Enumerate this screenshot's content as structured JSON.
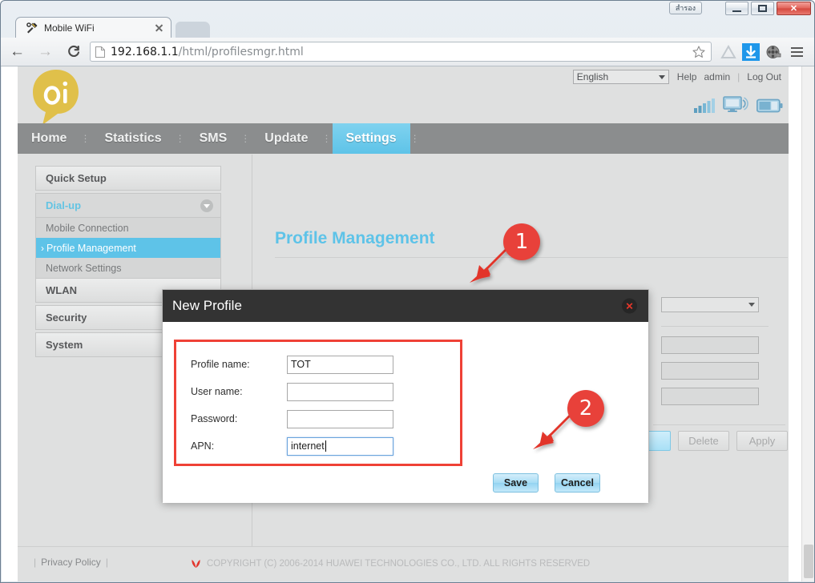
{
  "browser": {
    "window_buttons": {
      "thai_label": "สำรอง",
      "minimize": "minimize",
      "maximize": "maximize",
      "close": "✕"
    },
    "tab": {
      "title": "Mobile WiFi",
      "favicon": "tools-icon",
      "close": "✕"
    },
    "toolbar": {
      "back": "←",
      "forward": "→",
      "reload": "C",
      "url_host": "192.168.1.1",
      "url_path": "/html/profilesmgr.html",
      "star": "☆",
      "drive_icon": "drive-icon",
      "download_icon": "download-icon",
      "extension_icon": "film-reel-icon",
      "menu_icon": "hamburger-menu-icon"
    }
  },
  "site": {
    "logo_text": "oi",
    "language": {
      "selected": "English"
    },
    "header_links": [
      {
        "label": "Help"
      },
      {
        "label": "admin"
      },
      {
        "label": "Log Out"
      }
    ],
    "status_icons": [
      "signal-strength-icon",
      "wifi-monitor-icon",
      "battery-icon"
    ],
    "nav": [
      {
        "label": "Home",
        "active": false
      },
      {
        "label": "Statistics",
        "active": false
      },
      {
        "label": "SMS",
        "active": false
      },
      {
        "label": "Update",
        "active": false
      },
      {
        "label": "Settings",
        "active": true
      }
    ]
  },
  "sidebar": {
    "groups": [
      {
        "label": "Quick Setup",
        "type": "group",
        "open": false
      },
      {
        "label": "Dial-up",
        "type": "group",
        "open": true
      },
      {
        "label": "Mobile Connection",
        "type": "sub",
        "active": false
      },
      {
        "label": "Profile Management",
        "type": "sub",
        "active": true,
        "arrow": "›"
      },
      {
        "label": "Network Settings",
        "type": "sub",
        "active": false
      },
      {
        "label": "WLAN",
        "type": "group",
        "open": false
      },
      {
        "label": "Security",
        "type": "group",
        "open": false
      },
      {
        "label": "System",
        "type": "group",
        "open": false
      }
    ]
  },
  "content": {
    "title": "Profile Management",
    "background_buttons": [
      {
        "label": "",
        "style": "blue"
      },
      {
        "label": "Delete",
        "style": "disabled"
      },
      {
        "label": "Apply",
        "style": "disabled"
      }
    ]
  },
  "modal": {
    "title": "New Profile",
    "close": "✕",
    "fields": [
      {
        "label": "Profile name:",
        "value": "TOT",
        "focused": false
      },
      {
        "label": "User name:",
        "value": "",
        "focused": false
      },
      {
        "label": "Password:",
        "value": "",
        "focused": false
      },
      {
        "label": "APN:",
        "value": "internet",
        "focused": true
      }
    ],
    "buttons": [
      {
        "label": "Save"
      },
      {
        "label": "Cancel"
      }
    ]
  },
  "annotations": [
    {
      "number": "1",
      "target": "field-box"
    },
    {
      "number": "2",
      "target": "save-button"
    }
  ],
  "footer": {
    "privacy": "Privacy Policy",
    "copyright": "COPYRIGHT (C) 2006-2014 HUAWEI TECHNOLOGIES CO., LTD. ALL RIGHTS RESERVED",
    "brand_mark": "huawei-logo-icon"
  },
  "colors": {
    "accent_cyan": "#5ec3e8",
    "logo_gold": "#e0c04a",
    "annotation_red": "#e8413a",
    "highlight_red": "#ef4136",
    "modal_dark": "#333333"
  }
}
